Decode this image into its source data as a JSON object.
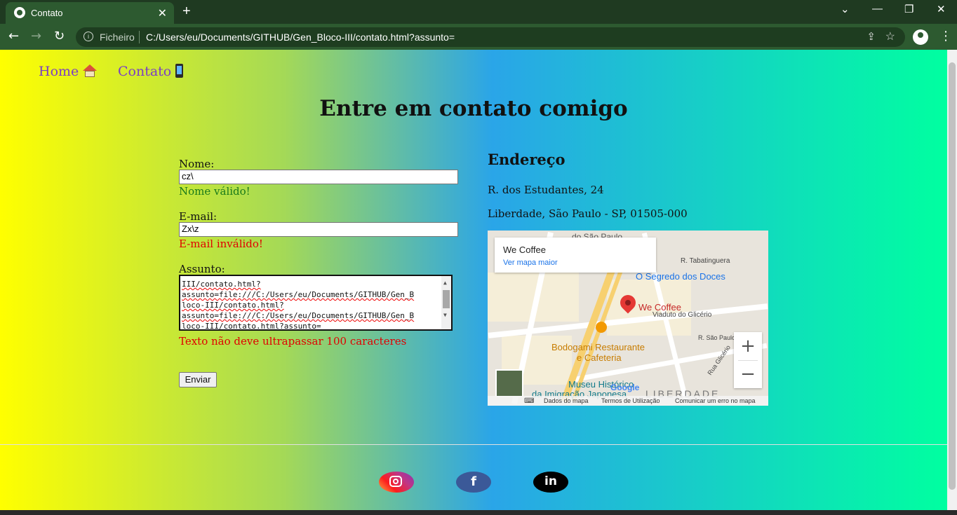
{
  "browser": {
    "tab_title": "Contato",
    "tab_close": "✕",
    "new_tab": "+",
    "scheme_label": "Ficheiro",
    "url": "C:/Users/eu/Documents/GITHUB/Gen_Bloco-III/contato.html?assunto=",
    "minimize": "—",
    "restore": "❐",
    "close": "✕",
    "chevron": "⌄"
  },
  "nav": {
    "home_label": "Home",
    "contact_label": "Contato"
  },
  "page": {
    "heading": "Entre em contato comigo"
  },
  "form": {
    "name_label": "Nome:",
    "name_value": "cz\\",
    "name_msg": "Nome válido!",
    "email_label": "E-mail:",
    "email_value": "Zx\\z",
    "email_msg": "E-mail inválido!",
    "subject_label": "Assunto:",
    "subject_lines": [
      "III/contato.html?",
      "assunto=file:///C:/Users/eu/Documents/GITHUB/Gen_B",
      "loco-III/contato.html?",
      "assunto=file:///C:/Users/eu/Documents/GITHUB/Gen_B",
      "loco-III/contato.html?assunto="
    ],
    "subject_msg": "Texto não deve ultrapassar 100 caracteres",
    "submit_label": "Enviar"
  },
  "address": {
    "heading": "Endereço",
    "line1": "R. dos Estudantes, 24",
    "line2": "Liberdade, São Paulo - SP, 01505-000"
  },
  "map": {
    "place_name": "We Coffee",
    "larger_map_link": "Ver mapa maior",
    "poi_1": "O Segredo dos Doces",
    "poi_2": "We Coffee",
    "poi_3": "Bodogami Restaurante",
    "poi_3b": "e Cafeteria",
    "poi_4": "Museu Histórico",
    "poi_4b": "da Imigração Japonesa",
    "street_1": "R. Tabatinguera",
    "street_2": "Viaduto do Glicério",
    "street_3": "R. São Paulo",
    "street_4": "Rua Glicério",
    "street_5": "do São Paulo",
    "district": "LIBERDADE",
    "google": "Google",
    "footer_data": "Dados do mapa",
    "footer_terms": "Termos de Utilização",
    "footer_report": "Comunicar um erro no mapa",
    "zoom_in": "+",
    "zoom_out": "−",
    "colors": {
      "pin": "#e53935",
      "link": "#1a73e8"
    }
  },
  "colors": {
    "nav_link": "#7b3fc4",
    "valid": "#1a7a1a",
    "invalid": "#e00000"
  }
}
